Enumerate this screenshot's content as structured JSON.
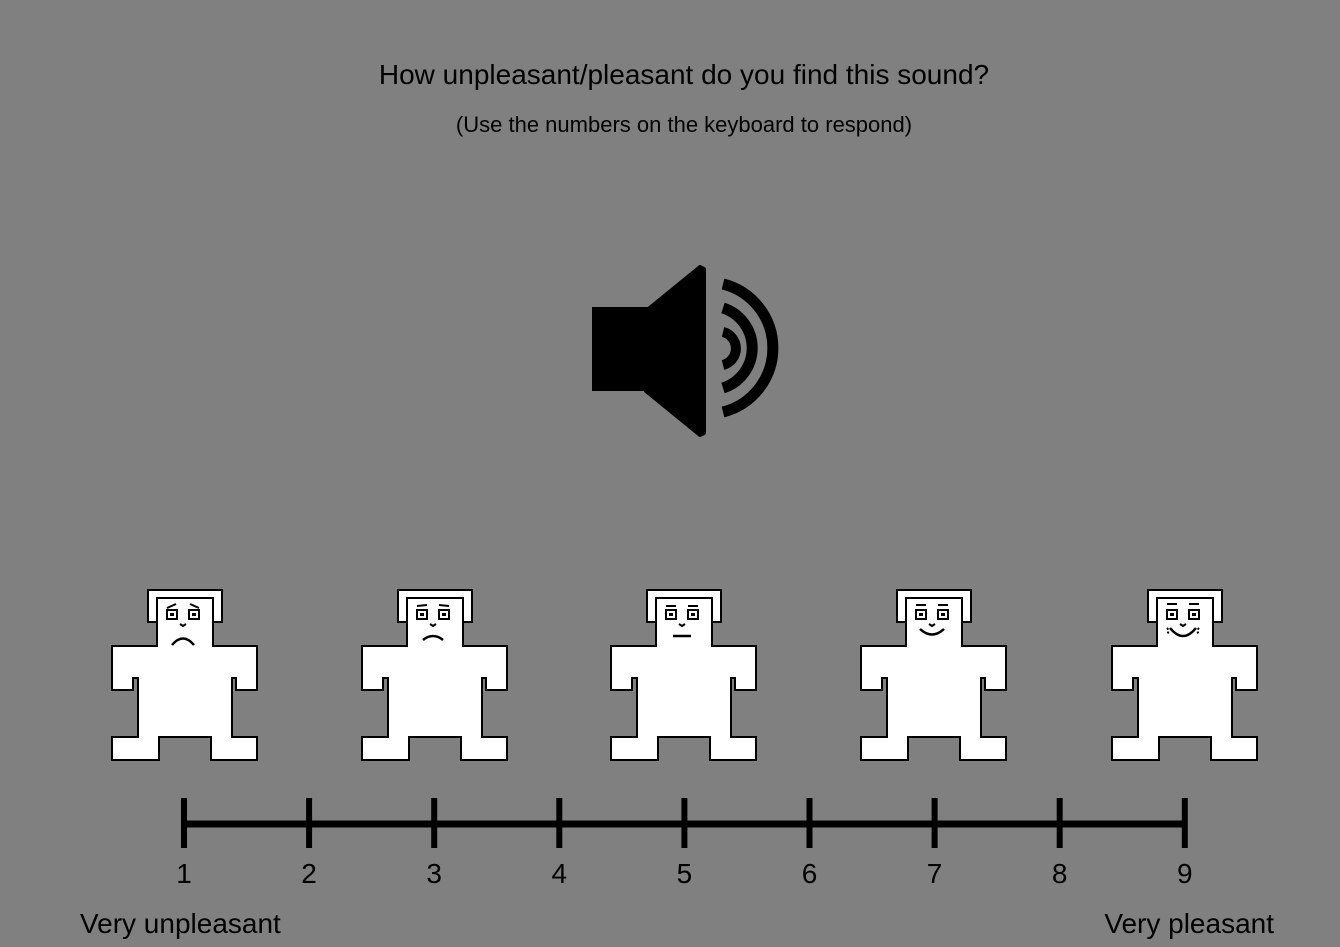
{
  "question": "How unpleasant/pleasant do you find this sound?",
  "instruction": "(Use the numbers on the keyboard to respond)",
  "stimulus_icon": "speaker-sound-icon",
  "sam_figures": [
    {
      "name": "sam-very-unpleasant-icon",
      "mood": "very-sad"
    },
    {
      "name": "sam-unpleasant-icon",
      "mood": "sad"
    },
    {
      "name": "sam-neutral-icon",
      "mood": "neutral"
    },
    {
      "name": "sam-pleasant-icon",
      "mood": "happy"
    },
    {
      "name": "sam-very-pleasant-icon",
      "mood": "very-happy"
    }
  ],
  "scale": {
    "ticks": [
      "1",
      "2",
      "3",
      "4",
      "5",
      "6",
      "7",
      "8",
      "9"
    ]
  },
  "anchors": {
    "left": "Very unpleasant",
    "right": "Very pleasant"
  },
  "colors": {
    "background": "#808080",
    "figure_fill": "#ffffff",
    "ink": "#000000"
  }
}
